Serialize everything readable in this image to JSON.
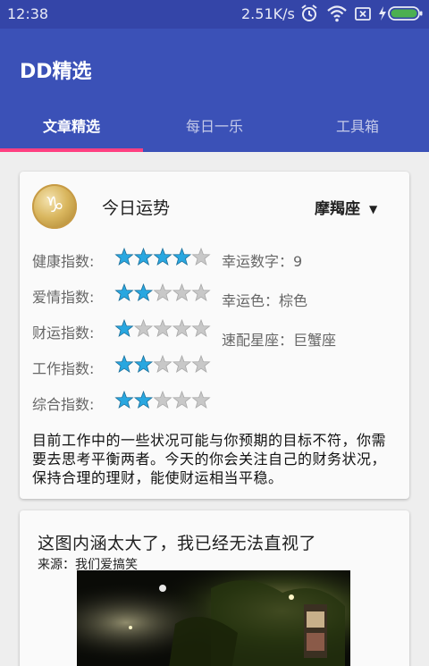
{
  "status_bar": {
    "time": "12:38",
    "net_speed": "2.51K/s",
    "icons": [
      "alarm-icon",
      "wifi-icon",
      "sim-icon",
      "charging-icon",
      "battery-icon"
    ]
  },
  "app": {
    "title": "DD精选"
  },
  "tabs": [
    {
      "label": "文章精选",
      "active": true
    },
    {
      "label": "每日一乐",
      "active": false
    },
    {
      "label": "工具箱",
      "active": false
    }
  ],
  "horoscope": {
    "title": "今日运势",
    "selected_sign": "摩羯座",
    "sign_icon": "capricorn-icon",
    "ratings": [
      {
        "label": "健康指数:",
        "stars": 4,
        "max": 5
      },
      {
        "label": "爱情指数:",
        "stars": 2,
        "max": 5
      },
      {
        "label": "财运指数:",
        "stars": 1,
        "max": 5
      },
      {
        "label": "工作指数:",
        "stars": 2,
        "max": 5
      },
      {
        "label": "综合指数:",
        "stars": 2,
        "max": 5
      }
    ],
    "lucky_number": "幸运数字：9",
    "lucky_color": "幸运色：棕色",
    "match_sign": "速配星座：巨蟹座",
    "description": "目前工作中的一些状况可能与你预期的目标不符，你需要去思考平衡两者。今天的你会关注自己的财务状况，保持合理的理财，能使财运相当平稳。"
  },
  "post": {
    "title": "这图内涵太大了，我已经无法直视了",
    "source": "来源：我们爱搞笑"
  },
  "colors": {
    "primary": "#3b51b7",
    "status_bar": "#3445a8",
    "accent": "#ff4081",
    "star_filled": "#29a7e0",
    "star_empty": "#c8c8c8"
  }
}
